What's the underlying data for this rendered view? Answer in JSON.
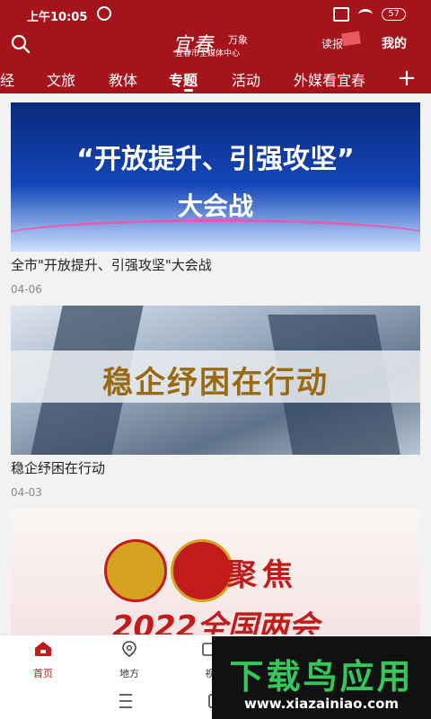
{
  "status_bar": {
    "time": "上午10:05",
    "battery": "57"
  },
  "header": {
    "logo_main": "宜春",
    "logo_sub_brand": "万象",
    "logo_tagline": "宜春市全媒体中心",
    "newspaper_label": "读报",
    "mine_label": "我的"
  },
  "tabs": [
    {
      "label": "经"
    },
    {
      "label": "文旅"
    },
    {
      "label": "教体"
    },
    {
      "label": "专题"
    },
    {
      "label": "活动"
    },
    {
      "label": "外媒看宜春"
    }
  ],
  "active_tab": "专题",
  "plus_label": "+",
  "articles": [
    {
      "banner_line1": "“开放提升、引强攻坚”",
      "banner_line2": "大会战",
      "title": "全市\"开放提升、引强攻坚\"大会战",
      "date": "04-06"
    },
    {
      "banner_line1": "稳企纾困在行动",
      "title": "稳企纾困在行动",
      "date": "04-03"
    },
    {
      "banner_line1": "聚焦",
      "banner_line2": "2022全国两会"
    }
  ],
  "bottom_nav": [
    {
      "label": "首页",
      "icon": "home-icon"
    },
    {
      "label": "地方",
      "icon": "map-pin-icon"
    },
    {
      "label": "视",
      "icon": "video-icon"
    }
  ],
  "watermark": {
    "text": "下载鸟应用",
    "url": "www.xiazainiao.com"
  },
  "colors": {
    "brand_red": "#a5131b",
    "active_red": "#c21b1b"
  }
}
